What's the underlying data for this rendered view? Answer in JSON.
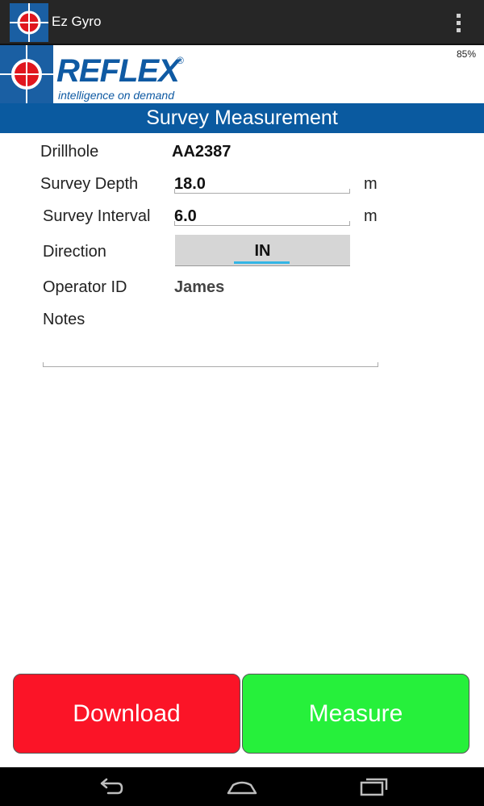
{
  "app": {
    "title": "Ez Gyro"
  },
  "header": {
    "brand": "REFLEX",
    "registered": "®",
    "tagline": "intelligence on demand",
    "battery": "85%"
  },
  "section": {
    "title": "Survey Measurement"
  },
  "form": {
    "drillhole_label": "Drillhole",
    "drillhole_value": "AA2387",
    "depth_label": "Survey Depth",
    "depth_value": "18.0",
    "depth_unit": "m",
    "interval_label": "Survey Interval",
    "interval_value": "6.0",
    "interval_unit": "m",
    "direction_label": "Direction",
    "direction_value": "IN",
    "operator_label": "Operator ID",
    "operator_value": "James",
    "notes_label": "Notes",
    "notes_value": ""
  },
  "buttons": {
    "download": "Download",
    "measure": "Measure"
  },
  "colors": {
    "brand_blue": "#0a5aa0",
    "download_red": "#fb1427",
    "measure_green": "#26f03b",
    "focus_blue": "#33b5e5"
  }
}
